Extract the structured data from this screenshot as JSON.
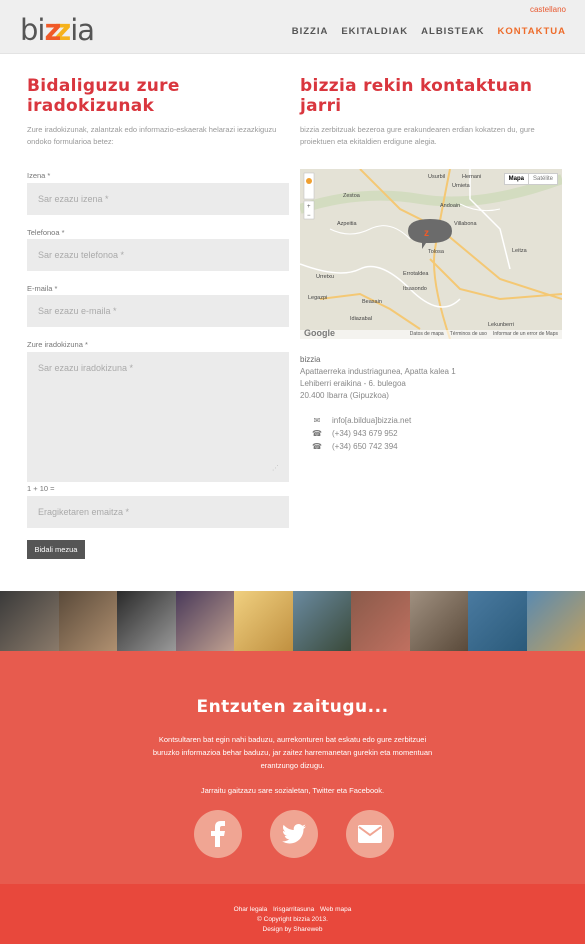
{
  "header": {
    "logo_text": "bizzia",
    "language": "castellano",
    "nav": [
      {
        "label": "BIZZIA",
        "active": false
      },
      {
        "label": "EKITALDIAK",
        "active": false
      },
      {
        "label": "ALBISTEAK",
        "active": false
      },
      {
        "label": "KONTAKTUA",
        "active": true
      }
    ]
  },
  "form": {
    "title": "Bidaliguzu zure iradokizunak",
    "intro": "Zure iradokizunak, zalantzak edo informazio-eskaerak helarazi iezazkiguzu ondoko formularioa betez:",
    "name_label": "Izena *",
    "name_placeholder": "Sar ezazu izena *",
    "phone_label": "Telefonoa *",
    "phone_placeholder": "Sar ezazu telefonoa *",
    "email_label": "E-maila *",
    "email_placeholder": "Sar ezazu e-maila *",
    "message_label": "Zure iradokizuna *",
    "message_placeholder": "Sar ezazu iradokizuna *",
    "captcha_label": "1 + 10 =",
    "captcha_placeholder": "Eragiketaren emaitza *",
    "submit_label": "Bidali mezua"
  },
  "contact": {
    "title": "bizzia rekin kontaktuan jarri",
    "intro": "bizzia zerbitzuak bezeroa gure erakundearen erdian kokatzen du, gure proiektuen eta ekitaldien erdigune alegia.",
    "map": {
      "type_map": "Mapa",
      "type_satellite": "Satélite",
      "google": "Google",
      "footer": [
        "Datos de mapa",
        "Términos de uso",
        "Informar de un error de Maps"
      ],
      "places": [
        "Usurbil",
        "Hernani",
        "Urnieta",
        "Zestoa",
        "Andoain",
        "Azpeitia",
        "Villabona",
        "Tolosa",
        "Leitza",
        "Urretxu",
        "Errotaldea",
        "Itsasondo",
        "Legazpi",
        "Beasain",
        "Idiazabal",
        "Lekunberri"
      ]
    },
    "address": {
      "name": "bizzia",
      "line1": "Apattaerreka industriagunea, Apatta kalea 1",
      "line2": "Lehiberri eraikina - 6. bulegoa",
      "line3": "20.400 Ibarra (Gipuzkoa)"
    },
    "email": "info[a.bildua]bizzia.net",
    "phone1": "(+34) 943 679 952",
    "phone2": "(+34) 650 742 394"
  },
  "band": {
    "title": "Entzuten zaitugu...",
    "text": "Kontsultaren bat egin nahi baduzu, aurrekonturen bat eskatu edo gure zerbitzuei buruzko informazioa behar baduzu, jar zaitez harremanetan gurekin eta momentuan erantzungo dizugu.",
    "follow": "Jarraitu gaitzazu sare sozialetan, Twitter eta Facebook."
  },
  "footer": {
    "links": [
      "Ohar legala",
      "Irisgarritasuna",
      "Web mapa"
    ],
    "copyright": "© Copyright bizzia 2013.",
    "design_prefix": "Design by",
    "design_by": "Shareweb"
  },
  "colors": {
    "accent": "#d9363e",
    "nav_active": "#ee6c2b",
    "band": "#e75b4e",
    "footer": "#e8483c"
  }
}
